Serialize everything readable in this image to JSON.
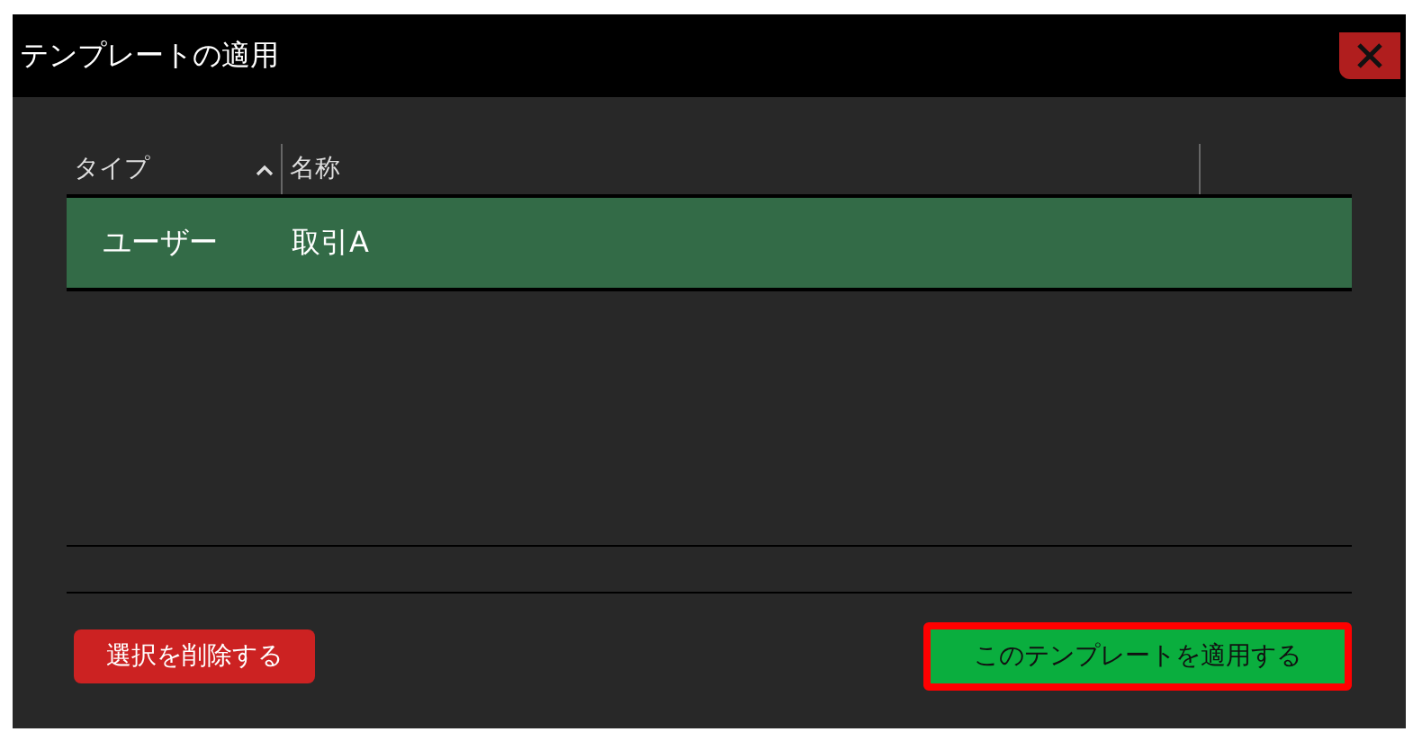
{
  "window": {
    "title": "テンプレートの適用"
  },
  "table": {
    "columns": [
      {
        "label": "タイプ",
        "sorted": true
      },
      {
        "label": "名称",
        "sorted": false
      }
    ],
    "rows": [
      {
        "cells": [
          "ユーザー",
          "取引A"
        ],
        "selected": true
      }
    ]
  },
  "buttons": [
    {
      "label": "選択を削除する",
      "kind": "danger",
      "highlighted": false
    },
    {
      "label": "このテンプレートを適用する",
      "kind": "primary",
      "highlighted": true
    }
  ]
}
